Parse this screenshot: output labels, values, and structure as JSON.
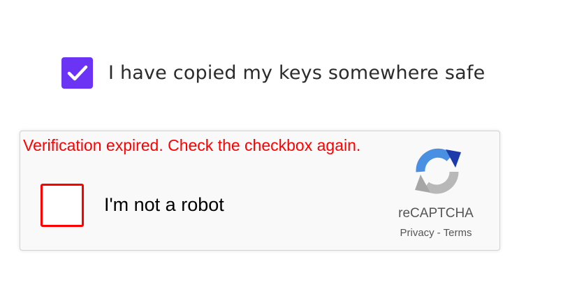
{
  "consent": {
    "checked": true,
    "label": "I have copied my keys somewhere safe",
    "accent_color": "#6b34f4"
  },
  "recaptcha": {
    "error_message": "Verification expired. Check the checkbox again.",
    "checkbox_checked": false,
    "checkbox_label": "I'm not a robot",
    "brand": "reCAPTCHA",
    "privacy_label": "Privacy",
    "separator": "-",
    "terms_label": "Terms",
    "error_color": "#ff0000",
    "logo_icon": "recaptcha-logo-icon"
  }
}
